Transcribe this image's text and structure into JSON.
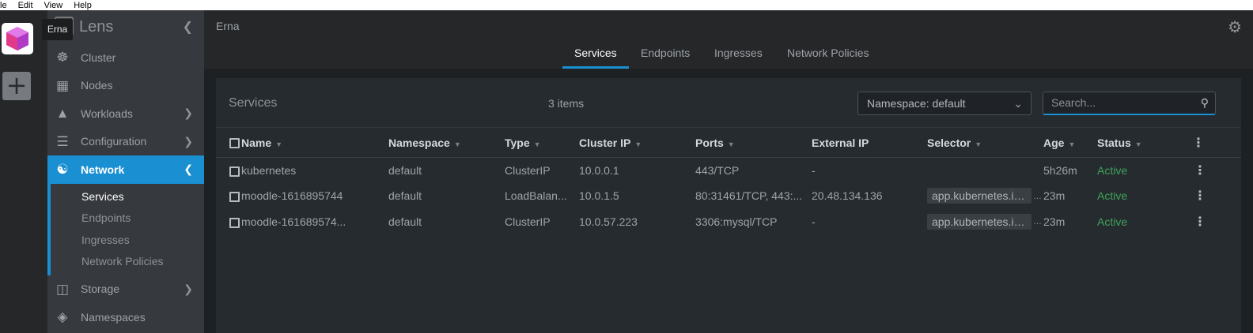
{
  "menubar": [
    "le",
    "Edit",
    "View",
    "Help"
  ],
  "rail": {
    "tooltip": "Erna",
    "add_label": "+"
  },
  "sidebar": {
    "title": "Lens",
    "items": [
      {
        "label": "Cluster",
        "icon": "helm-wheel-icon",
        "expandable": false
      },
      {
        "label": "Nodes",
        "icon": "nodes-icon",
        "expandable": false
      },
      {
        "label": "Workloads",
        "icon": "cubes-icon",
        "expandable": true
      },
      {
        "label": "Configuration",
        "icon": "list-icon",
        "expandable": true
      },
      {
        "label": "Network",
        "icon": "network-icon",
        "expandable": true,
        "active": true
      },
      {
        "label": "Storage",
        "icon": "database-icon",
        "expandable": true
      },
      {
        "label": "Namespaces",
        "icon": "layers-icon",
        "expandable": false
      }
    ],
    "network_sub": [
      "Services",
      "Endpoints",
      "Ingresses",
      "Network Policies"
    ],
    "current_sub": "Services"
  },
  "topbar": {
    "cluster_name": "Erna"
  },
  "tabs": [
    "Services",
    "Endpoints",
    "Ingresses",
    "Network Policies"
  ],
  "active_tab": "Services",
  "panel": {
    "title": "Services",
    "count": "3 items",
    "namespace_select": "Namespace: default",
    "search_placeholder": "Search..."
  },
  "table": {
    "columns": [
      "Name",
      "Namespace",
      "Type",
      "Cluster IP",
      "Ports",
      "External IP",
      "Selector",
      "Age",
      "Status"
    ],
    "rows": [
      {
        "name": "kubernetes",
        "namespace": "default",
        "type": "ClusterIP",
        "cluster_ip": "10.0.0.1",
        "ports": "443/TCP",
        "external_ip": "-",
        "selector": "",
        "age": "5h26m",
        "status": "Active"
      },
      {
        "name": "moodle-1616895744",
        "namespace": "default",
        "type": "LoadBalan...",
        "cluster_ip": "10.0.1.5",
        "ports": "80:31461/TCP, 443:...",
        "external_ip": "20.48.134.136",
        "selector": "app.kubernetes.io...",
        "age": "23m",
        "status": "Active"
      },
      {
        "name": "moodle-161689574...",
        "namespace": "default",
        "type": "ClusterIP",
        "cluster_ip": "10.0.57.223",
        "ports": "3306:mysql/TCP",
        "external_ip": "-",
        "selector": "app.kubernetes.io...",
        "age": "23m",
        "status": "Active"
      }
    ]
  },
  "colors": {
    "accent": "#1a8fd1",
    "status_active": "#3ea35a",
    "sidebar_bg": "#36393e",
    "main_bg": "#1e2124"
  }
}
